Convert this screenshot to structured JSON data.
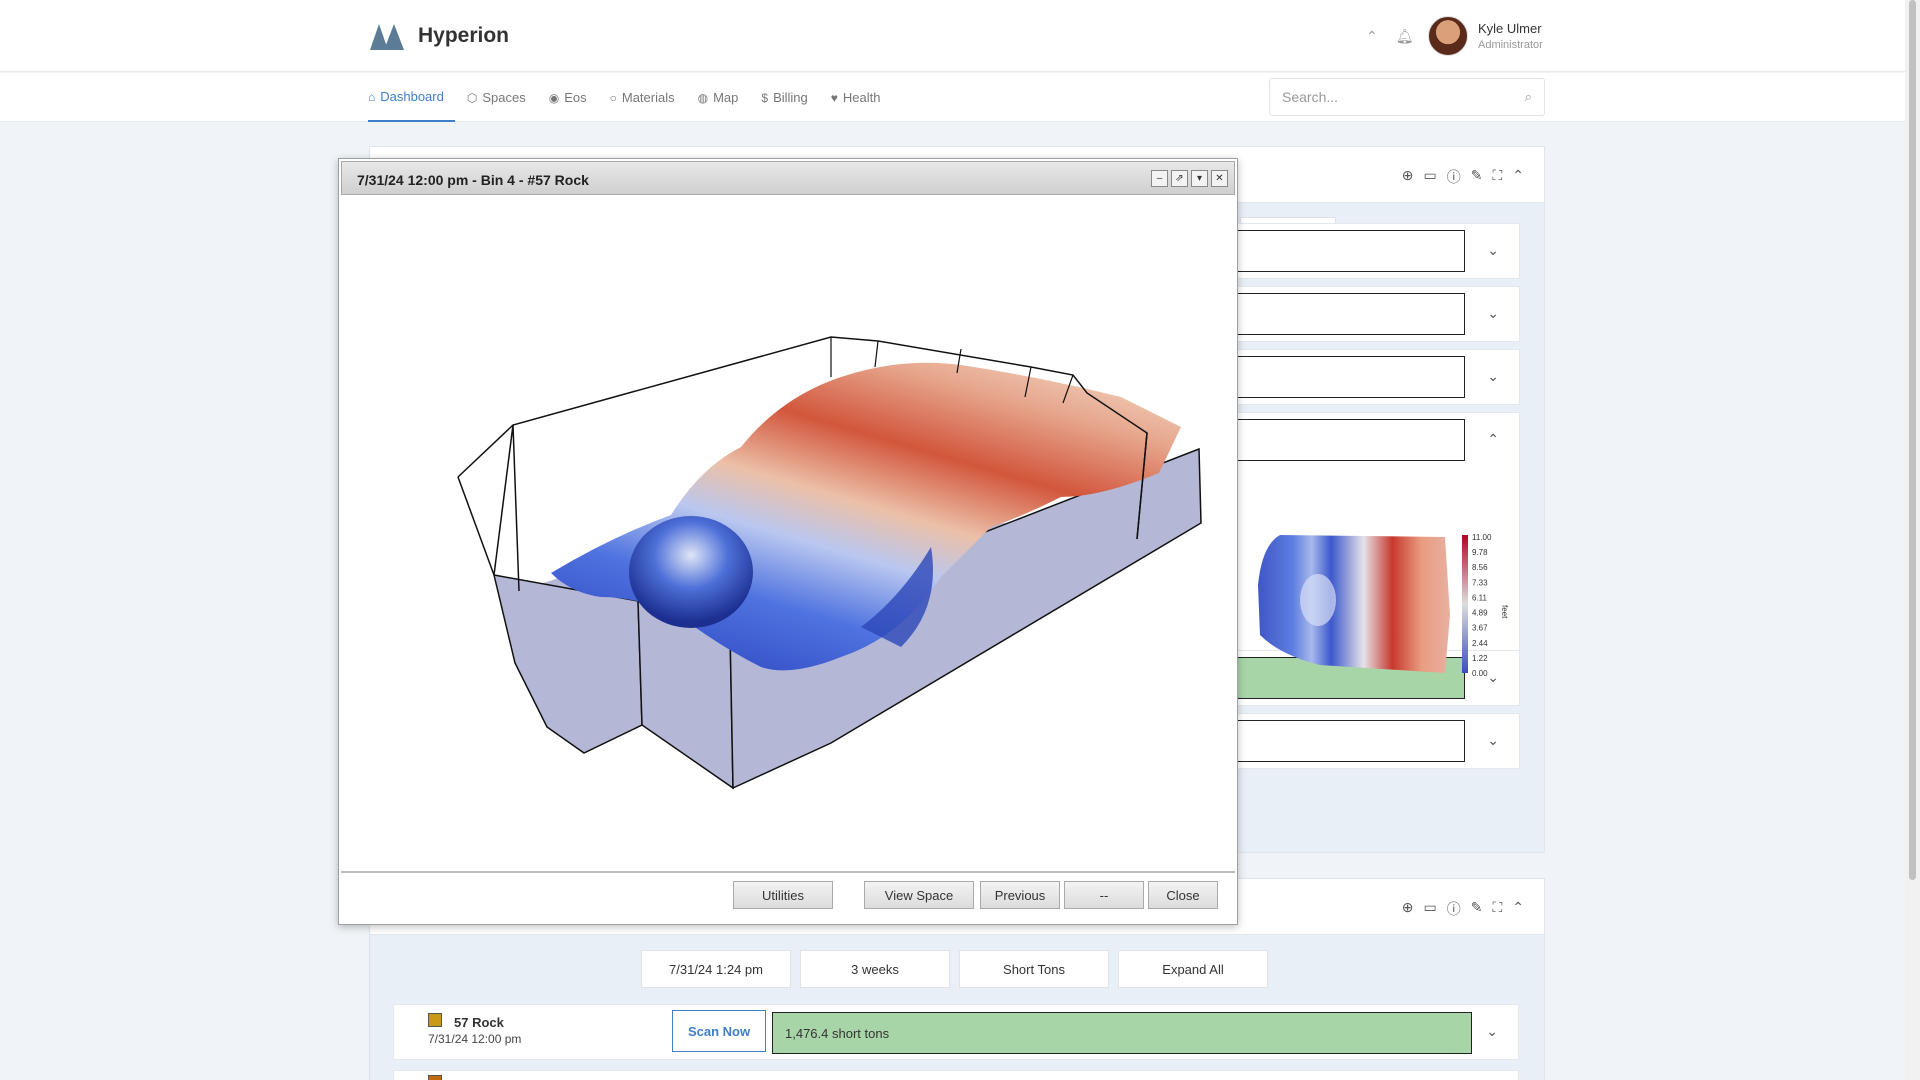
{
  "header": {
    "brand": "Hyperion",
    "user": {
      "name": "Kyle Ulmer",
      "role": "Administrator"
    }
  },
  "nav": {
    "items": [
      {
        "label": "Dashboard",
        "icon": "home-icon",
        "glyph": "⌂",
        "active": true
      },
      {
        "label": "Spaces",
        "icon": "cube-icon",
        "glyph": "⬡",
        "active": false
      },
      {
        "label": "Eos",
        "icon": "eye-icon",
        "glyph": "◉",
        "active": false
      },
      {
        "label": "Materials",
        "icon": "circle-icon",
        "glyph": "○",
        "active": false
      },
      {
        "label": "Map",
        "icon": "globe-icon",
        "glyph": "◍",
        "active": false
      },
      {
        "label": "Billing",
        "icon": "dollar-icon",
        "glyph": "$",
        "active": false
      },
      {
        "label": "Health",
        "icon": "heartbeat-icon",
        "glyph": "♥",
        "active": false
      }
    ],
    "search_placeholder": "Search..."
  },
  "panel1": {
    "rows": [
      {
        "fill": 0,
        "expanded": false
      },
      {
        "fill": 0,
        "expanded": false
      },
      {
        "fill": 0.16,
        "expanded": false
      },
      {
        "fill": 0,
        "expanded": true
      },
      {
        "fill": 1.0,
        "expanded": false
      },
      {
        "fill": 0.11,
        "expanded": false
      }
    ],
    "colorbar": {
      "unit": "feet",
      "ticks": [
        "11.00",
        "9.78",
        "8.56",
        "7.33",
        "6.11",
        "4.89",
        "3.67",
        "2.44",
        "1.22",
        "0.00"
      ]
    }
  },
  "panel2": {
    "controls": {
      "date": "7/31/24 1:24 pm",
      "range": "3 weeks",
      "units": "Short Tons",
      "expand": "Expand All"
    },
    "row": {
      "name": "57 Rock",
      "time": "7/31/24 12:00 pm",
      "scan_label": "Scan Now",
      "value": "1,476.4 short tons",
      "swatch": "#c89b16"
    }
  },
  "modal": {
    "title": "7/31/24 12:00 pm - Bin 4 - #57 Rock",
    "buttons": {
      "utilities": "Utilities",
      "view_space": "View Space",
      "previous": "Previous",
      "next": "--",
      "close": "Close"
    }
  },
  "colors": {
    "accent": "#3f7fca",
    "fill_green": "#a8d5a8",
    "surface_base": "#b4b8d6"
  }
}
